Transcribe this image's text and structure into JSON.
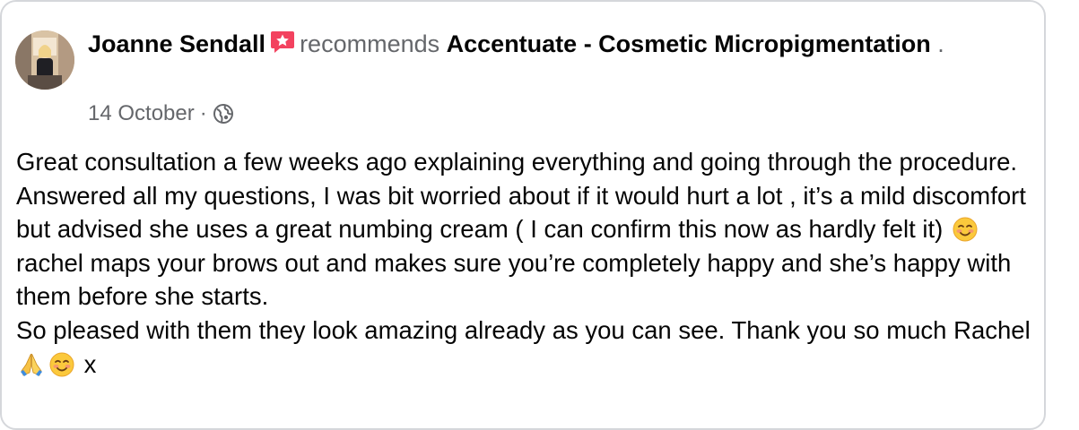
{
  "post": {
    "author": "Joanne Sendall",
    "verb": "recommends",
    "page": "Accentuate - Cosmetic Micropigmentation",
    "trailing_dot": ".",
    "date": "14 October",
    "separator": "·",
    "body_1": "Great consultation a few weeks ago  explaining everything and going through the procedure. Answered all my questions, I was bit worried about if it would hurt a lot , it’s a mild discomfort but advised she uses a great numbing cream ( I can confirm this now as hardly felt it)",
    "body_2": "rachel maps your brows out and makes sure you’re completely happy and she’s happy with them before she starts.",
    "body_3": "So pleased with them they look amazing already as you can see. Thank you so much Rachel",
    "body_end": "x"
  },
  "icons": {
    "recommend": "recommend-star-icon",
    "privacy": "globe-icon",
    "emoji_smile": "smiling-face-emoji",
    "emoji_pray": "folded-hands-emoji"
  },
  "colors": {
    "text": "#050505",
    "secondary": "#65676b",
    "recommend_red": "#f3425f",
    "card_border": "#d5d7db"
  }
}
